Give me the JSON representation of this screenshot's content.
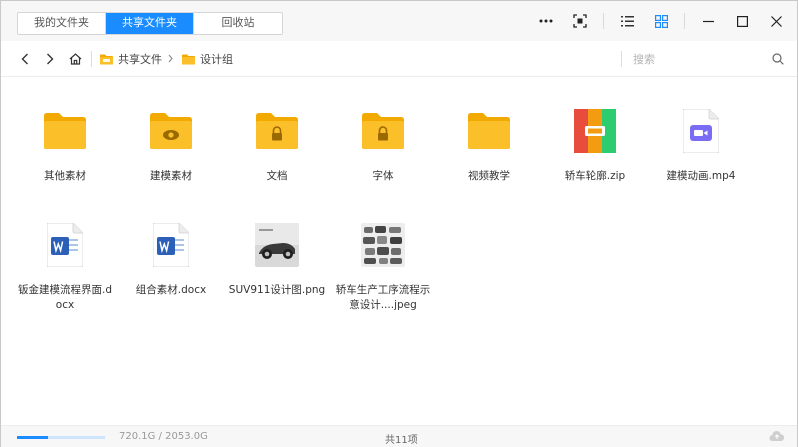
{
  "tabs": [
    {
      "label": "我的文件夹",
      "active": false
    },
    {
      "label": "共享文件夹",
      "active": true
    },
    {
      "label": "回收站",
      "active": false
    }
  ],
  "breadcrumb": {
    "root": "共享文件",
    "current": "设计组"
  },
  "search": {
    "placeholder": "搜索"
  },
  "files": [
    {
      "name": "其他素材",
      "type": "folder",
      "icon": "folder-icon"
    },
    {
      "name": "建模素材",
      "type": "folder-eye",
      "icon": "folder-eye-icon"
    },
    {
      "name": "文档",
      "type": "folder-lock",
      "icon": "folder-lock-icon"
    },
    {
      "name": "字体",
      "type": "folder-lock",
      "icon": "folder-lock-icon"
    },
    {
      "name": "视频教学",
      "type": "folder",
      "icon": "folder-icon"
    },
    {
      "name": "轿车轮廓.zip",
      "type": "zip",
      "icon": "zip-archive-icon"
    },
    {
      "name": "建模动画.mp4",
      "type": "video",
      "icon": "video-file-icon"
    },
    {
      "name": "钣金建模流程界面.docx",
      "type": "word",
      "icon": "word-document-icon"
    },
    {
      "name": "组合素材.docx",
      "type": "word",
      "icon": "word-document-icon"
    },
    {
      "name": "SUV911设计图.png",
      "type": "image-car",
      "icon": "image-thumbnail"
    },
    {
      "name": "轿车生产工序流程示意设计....jpeg",
      "type": "image-parts",
      "icon": "image-thumbnail"
    }
  ],
  "status": {
    "storage": "720.1G / 2053.0G",
    "usage_fraction": 0.35,
    "count": "共11项"
  },
  "colors": {
    "accent": "#1a8cff",
    "folder": "#fbbf2a",
    "folder_tab": "#f2a900"
  }
}
